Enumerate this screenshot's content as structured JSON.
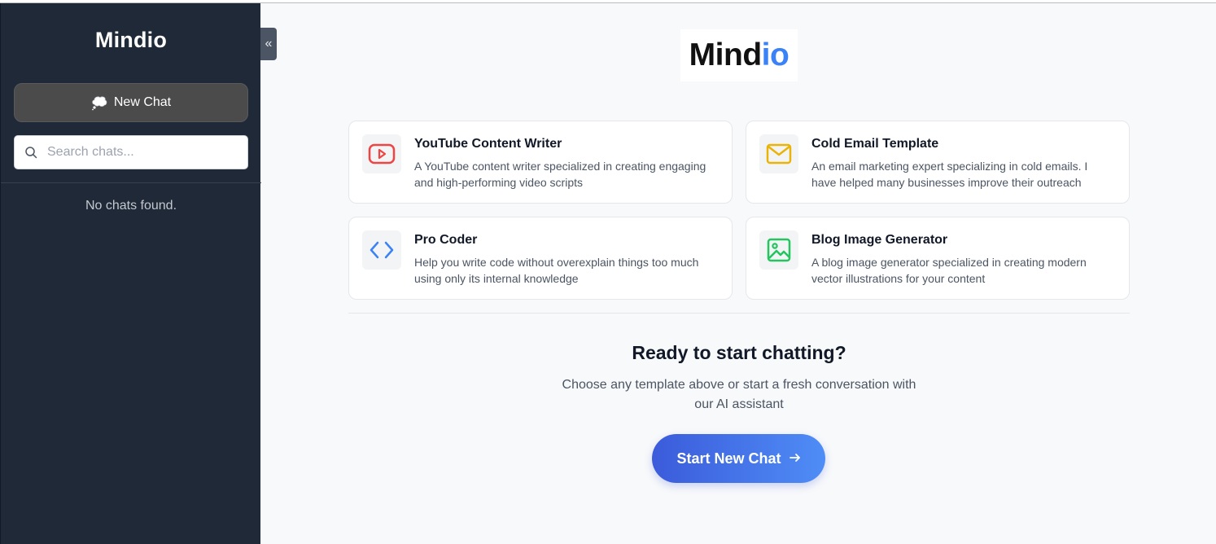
{
  "sidebar": {
    "brand": "Mindio",
    "new_chat_label": "New Chat",
    "search_placeholder": "Search chats...",
    "empty_text": "No chats found.",
    "collapse_symbol": "«"
  },
  "main": {
    "logo_part1": "Mind",
    "logo_part2": "io",
    "templates": [
      {
        "title": "YouTube Content Writer",
        "description": "A YouTube content writer specialized in creating engaging and high-performing video scripts",
        "icon": "youtube-play-icon",
        "color": "#ef4444"
      },
      {
        "title": "Cold Email Template",
        "description": "An email marketing expert specializing in cold emails. I have helped many businesses improve their outreach",
        "icon": "mail-icon",
        "color": "#eab308"
      },
      {
        "title": "Pro Coder",
        "description": "Help you write code without overexplain things too much using only its internal knowledge",
        "icon": "code-icon",
        "color": "#3b82f6"
      },
      {
        "title": "Blog Image Generator",
        "description": "A blog image generator specialized in creating modern vector illustrations for your content",
        "icon": "image-icon",
        "color": "#22c55e"
      }
    ],
    "cta_title": "Ready to start chatting?",
    "cta_subtitle": "Choose any template above or start a fresh conversation with our AI assistant",
    "start_button_label": "Start New Chat"
  },
  "colors": {
    "sidebar_bg": "#1f2937",
    "accent": "#3b82f6"
  }
}
